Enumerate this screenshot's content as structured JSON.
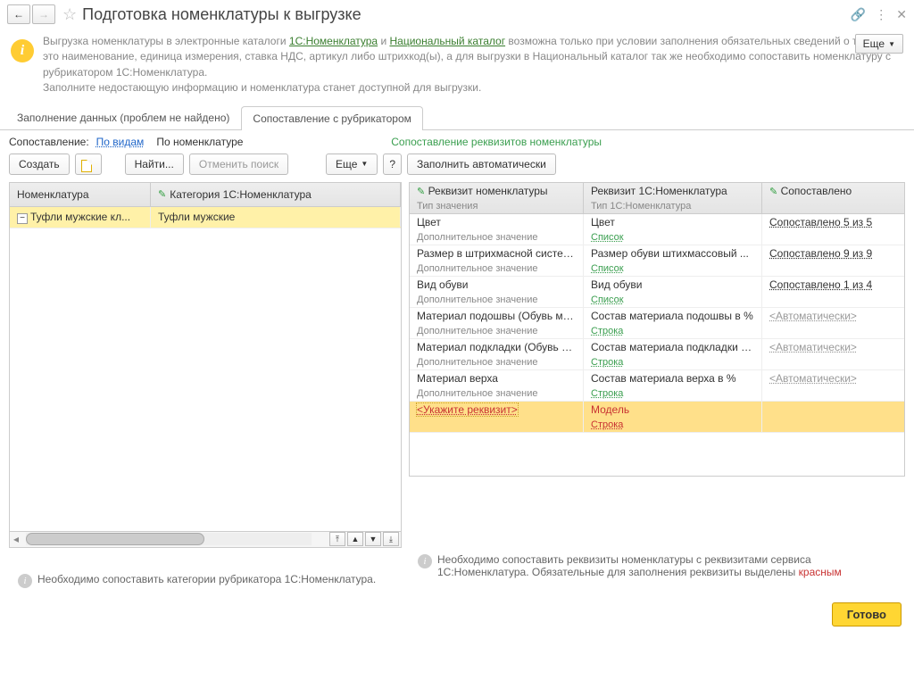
{
  "titlebar": {
    "title": "Подготовка номенклатуры к выгрузке"
  },
  "banner": {
    "line_prefix": "Выгрузка номенклатуры в электронные каталоги ",
    "link1": "1С:Номенклатура",
    "mid": " и ",
    "link2": "Национальный каталог",
    "line_suffix": " возможна только при условии заполнения обязательных сведений о товаре – это наименование, единица измерения, ставка НДС, артикул либо штрихкод(ы), а для выгрузки в Национальный каталог так же необходимо сопоставить номенклатуру с рубрикатором 1С:Номенклатура.",
    "line2": "Заполните недостающую информацию и номенклатура станет доступной для выгрузки.",
    "more": "Еще"
  },
  "tabs": {
    "tab1": "Заполнение данных (проблем не найдено)",
    "tab2": "Сопоставление с рубрикатором"
  },
  "filters": {
    "label": "Сопоставление:",
    "by_kinds": "По видам",
    "by_nom": "По номенклатуре",
    "right_title": "Сопоставление реквизитов номенклатуры"
  },
  "toolbar": {
    "create": "Создать",
    "find": "Найти...",
    "cancel_search": "Отменить поиск",
    "more": "Еще",
    "auto_fill": "Заполнить автоматически"
  },
  "left_grid": {
    "col1": "Номенклатура",
    "col2": "Категория 1С:Номенклатура",
    "row1_nom": "Туфли мужские кл...",
    "row1_cat": "Туфли мужские"
  },
  "right_grid": {
    "col1": "Реквизит номенклатуры",
    "col1_sub": "Тип значения",
    "col2": "Реквизит 1С:Номенклатура",
    "col2_sub": "Тип 1С:Номенклатура",
    "col3": "Сопоставлено",
    "rows": [
      {
        "a": "Цвет",
        "a2": "Дополнительное значение",
        "b": "Цвет",
        "b2": "Список",
        "c": "Сопоставлено 5 из 5",
        "ctype": "link"
      },
      {
        "a": "Размер в штрихмасной системе",
        "a2": "Дополнительное значение",
        "b": "Размер обуви штихмассовый ...",
        "b2": "Список",
        "c": "Сопоставлено 9 из 9",
        "ctype": "link"
      },
      {
        "a": "Вид обуви",
        "a2": "Дополнительное значение",
        "b": "Вид обуви",
        "b2": "Список",
        "c": "Сопоставлено 1 из 4",
        "ctype": "link"
      },
      {
        "a": "Материал подошвы (Обувь ма...",
        "a2": "Дополнительное значение",
        "b": "Состав материала подошвы в %",
        "b2": "Строка",
        "c": "<Автоматически>",
        "ctype": "gray"
      },
      {
        "a": "Материал подкладки (Обувь м...",
        "a2": "Дополнительное значение",
        "b": "Состав материала подкладки в %",
        "b2": "Строка",
        "c": "<Автоматически>",
        "ctype": "gray"
      },
      {
        "a": "Материал верха",
        "a2": "Дополнительное значение",
        "b": "Состав материала верха в %",
        "b2": "Строка",
        "c": "<Автоматически>",
        "ctype": "gray"
      },
      {
        "a": "<Укажите реквизит>",
        "a2": "",
        "b": "Модель",
        "b2": "Строка",
        "c": "",
        "ctype": "red",
        "selected": true
      }
    ]
  },
  "hints": {
    "left": "Необходимо сопоставить категории рубрикатора 1С:Номенклатура.",
    "right_a": "Необходимо сопоставить реквизиты номенклатуры с реквизитами сервиса 1С:Номенклатура. Обязательные для заполнения реквизиты выделены ",
    "right_b": "красным"
  },
  "footer": {
    "done": "Готово"
  }
}
